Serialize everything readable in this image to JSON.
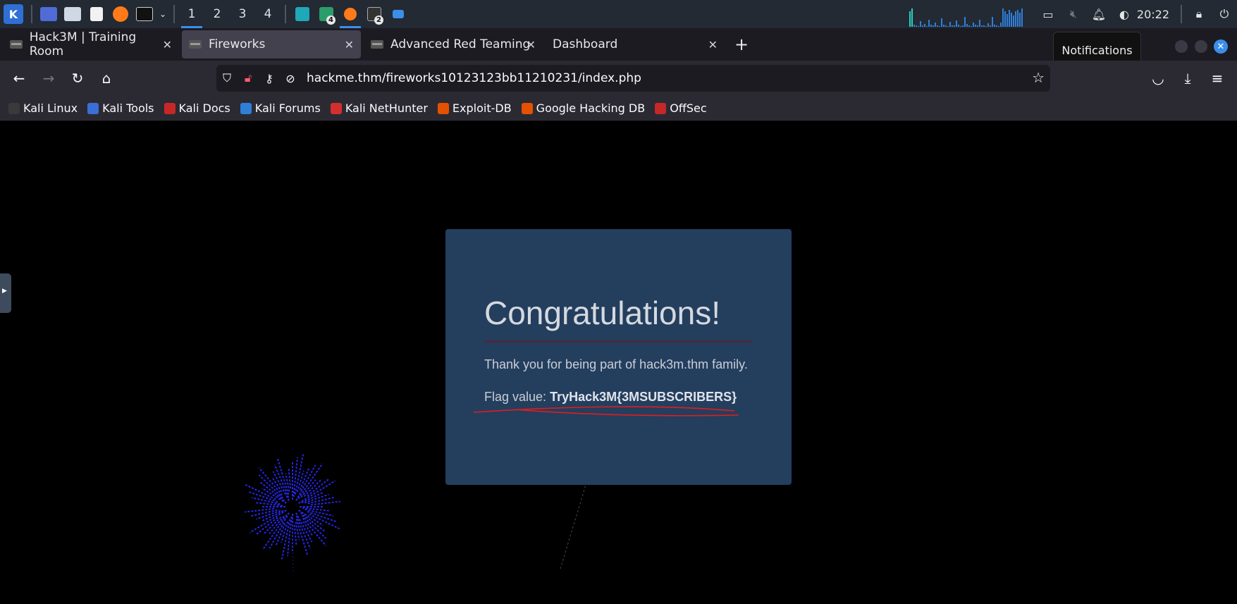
{
  "panel": {
    "workspaces": [
      "1",
      "2",
      "3",
      "4"
    ],
    "active_workspace": "1",
    "badges": {
      "files_task": "4",
      "terminal_task": "2"
    },
    "clock": "20:22"
  },
  "tabs": [
    {
      "title": "Hack3M | Training Room",
      "active": false
    },
    {
      "title": "Fireworks",
      "active": true
    },
    {
      "title": "Advanced Red Teaming",
      "active": false
    },
    {
      "title": "Dashboard",
      "active": false
    }
  ],
  "tooltip": "Notifications",
  "navbar": {
    "url": "hackme.thm/fireworks10123123bb11210231/index.php"
  },
  "bookmarks": [
    {
      "label": "Kali Linux",
      "color": "#3a3a3a"
    },
    {
      "label": "Kali Tools",
      "color": "#3b6fd6"
    },
    {
      "label": "Kali Docs",
      "color": "#c62828"
    },
    {
      "label": "Kali Forums",
      "color": "#2f7fd9"
    },
    {
      "label": "Kali NetHunter",
      "color": "#d32f2f"
    },
    {
      "label": "Exploit-DB",
      "color": "#e65100"
    },
    {
      "label": "Google Hacking DB",
      "color": "#e65100"
    },
    {
      "label": "OffSec",
      "color": "#c62828"
    }
  ],
  "card": {
    "title": "Congratulations!",
    "message": "Thank you for being part of hack3m.thm family.",
    "flag_label": "Flag value:",
    "flag_value": "TryHack3M{3MSUBSCRIBERS}"
  },
  "colors": {
    "card_bg": "#243e5e",
    "accent": "#3b8eea",
    "firework": "#2b2bff",
    "annotation": "#e01e1e"
  }
}
